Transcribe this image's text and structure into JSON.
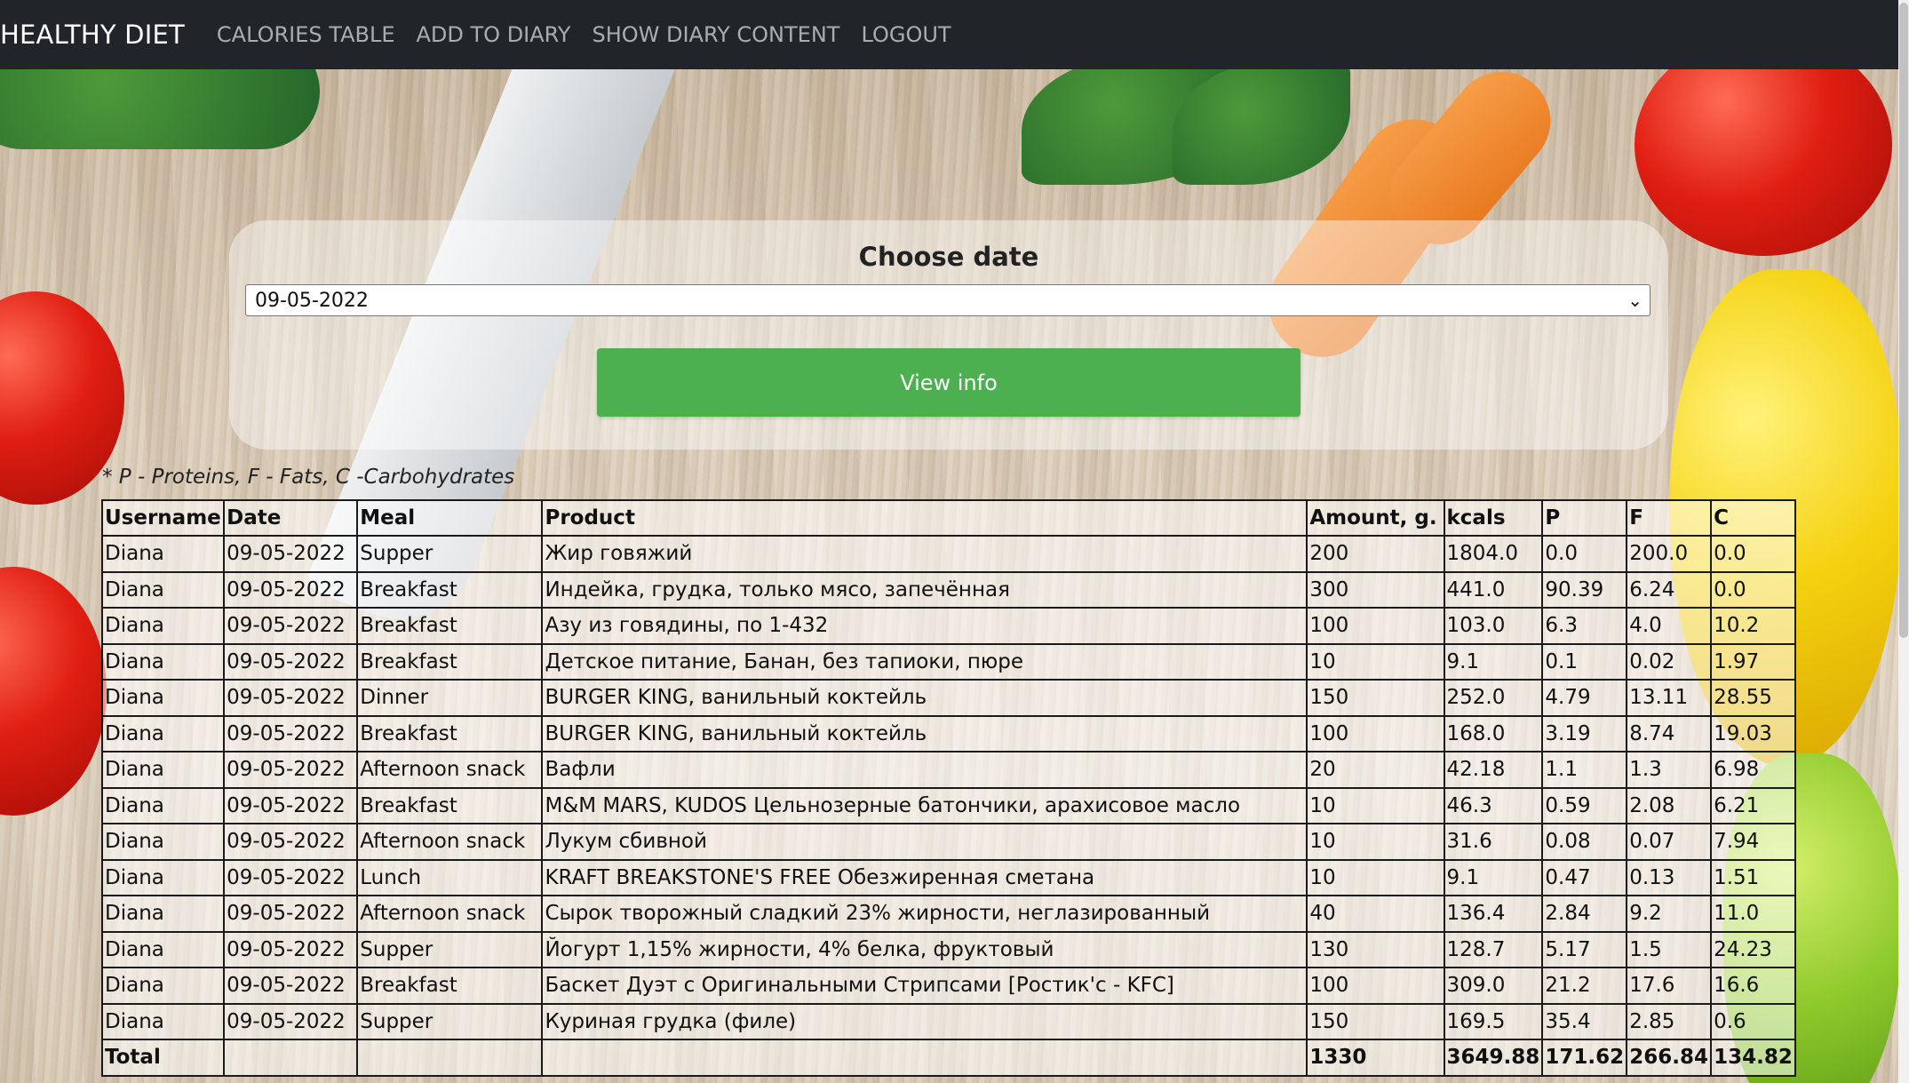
{
  "navbar": {
    "brand": "HEALTHY DIET",
    "links": [
      "CALORIES TABLE",
      "ADD TO DIARY",
      "SHOW DIARY CONTENT",
      "LOGOUT"
    ]
  },
  "form": {
    "title": "Choose date",
    "selected_date": "09-05-2022",
    "button_label": "View info"
  },
  "legend_note": "* P - Proteins, F - Fats, C -Carbohydrates",
  "table": {
    "headers": [
      "Username",
      "Date",
      "Meal",
      "Product",
      "Amount, g.",
      "kcals",
      "P",
      "F",
      "C"
    ],
    "rows": [
      [
        "Diana",
        "09-05-2022",
        "Supper",
        "Жир говяжий",
        "200",
        "1804.0",
        "0.0",
        "200.0",
        "0.0"
      ],
      [
        "Diana",
        "09-05-2022",
        "Breakfast",
        "Индейка, грудка, только мясо, запечённая",
        "300",
        "441.0",
        "90.39",
        "6.24",
        "0.0"
      ],
      [
        "Diana",
        "09-05-2022",
        "Breakfast",
        "Азу из говядины, по 1-432",
        "100",
        "103.0",
        "6.3",
        "4.0",
        "10.2"
      ],
      [
        "Diana",
        "09-05-2022",
        "Breakfast",
        "Детское питание, Банан, без тапиоки, пюре",
        "10",
        "9.1",
        "0.1",
        "0.02",
        "1.97"
      ],
      [
        "Diana",
        "09-05-2022",
        "Dinner",
        "BURGER KING, ванильный коктейль",
        "150",
        "252.0",
        "4.79",
        "13.11",
        "28.55"
      ],
      [
        "Diana",
        "09-05-2022",
        "Breakfast",
        "BURGER KING, ванильный коктейль",
        "100",
        "168.0",
        "3.19",
        "8.74",
        "19.03"
      ],
      [
        "Diana",
        "09-05-2022",
        "Afternoon snack",
        "Вафли",
        "20",
        "42.18",
        "1.1",
        "1.3",
        "6.98"
      ],
      [
        "Diana",
        "09-05-2022",
        "Breakfast",
        "M&M MARS, KUDOS Цельнозерные батончики, арахисовое масло",
        "10",
        "46.3",
        "0.59",
        "2.08",
        "6.21"
      ],
      [
        "Diana",
        "09-05-2022",
        "Afternoon snack",
        "Лукум сбивной",
        "10",
        "31.6",
        "0.08",
        "0.07",
        "7.94"
      ],
      [
        "Diana",
        "09-05-2022",
        "Lunch",
        "KRAFT BREAKSTONE'S FREE Обезжиренная сметана",
        "10",
        "9.1",
        "0.47",
        "0.13",
        "1.51"
      ],
      [
        "Diana",
        "09-05-2022",
        "Afternoon snack",
        "Сырок творожный сладкий 23% жирности, неглазированный",
        "40",
        "136.4",
        "2.84",
        "9.2",
        "11.0"
      ],
      [
        "Diana",
        "09-05-2022",
        "Supper",
        "Йогурт 1,15% жирности, 4% белка, фруктовый",
        "130",
        "128.7",
        "5.17",
        "1.5",
        "24.23"
      ],
      [
        "Diana",
        "09-05-2022",
        "Breakfast",
        "Баскет Дуэт с Оригинальными Стрипсами [Ростик'с - KFC]",
        "100",
        "309.0",
        "21.2",
        "17.6",
        "16.6"
      ],
      [
        "Diana",
        "09-05-2022",
        "Supper",
        "Куриная грудка (филе)",
        "150",
        "169.5",
        "35.4",
        "2.85",
        "0.6"
      ]
    ],
    "total": [
      "Total",
      "",
      "",
      "",
      "1330",
      "3649.88",
      "171.62",
      "266.84",
      "134.82"
    ]
  },
  "colors": {
    "navbar_bg": "#212529",
    "button_bg": "#4caf50"
  }
}
